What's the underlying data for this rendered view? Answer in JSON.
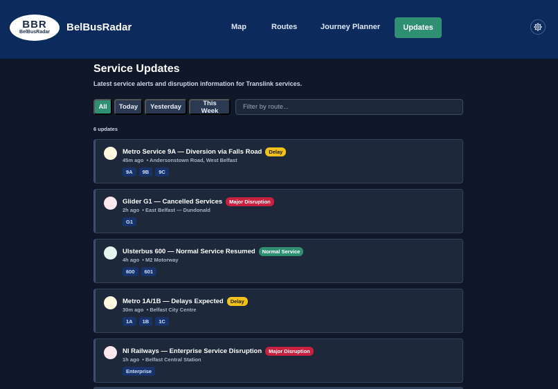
{
  "header": {
    "logo_text": "BBR",
    "logo_subtext": "BelBusRadar",
    "brand": "BelBusRadar",
    "nav": [
      "Map",
      "Routes",
      "Journey Planner",
      "Updates"
    ],
    "active_nav": "Updates",
    "settings_icon": "gear-icon"
  },
  "page": {
    "title": "Service Updates",
    "subtitle": "Latest service alerts and disruption information for Translink services.",
    "filters": [
      "All",
      "Today",
      "Yesterday",
      "This Week"
    ],
    "active_filter": "All",
    "route_filter_placeholder": "Filter by route...",
    "count_text": "6 updates"
  },
  "colors": {
    "accent": "#2f8f72",
    "nav_bg": "#0c2a5c",
    "delay_badge": "#f2c21b",
    "major_disruption_badge": "#c8203f",
    "normal_service_badge": "#2f8f72"
  },
  "updates": [
    {
      "title": "Metro Service 9A — Diversion via Falls Road",
      "status": "Delay",
      "time": "45m ago",
      "location": "• Andersonstown Road, West Belfast",
      "routes": [
        "9A",
        "9B",
        "9C"
      ]
    },
    {
      "title": "Glider G1 — Cancelled Services",
      "status": "Major Disruption",
      "time": "2h ago",
      "location": "• East Belfast — Dundonald",
      "routes": [
        "G1"
      ]
    },
    {
      "title": "Ulsterbus 600 — Normal Service Resumed",
      "status": "Normal Service",
      "time": "4h ago",
      "location": "• M2 Motorway",
      "routes": [
        "600",
        "601"
      ]
    },
    {
      "title": "Metro 1A/1B — Delays Expected",
      "status": "Delay",
      "time": "30m ago",
      "location": "• Belfast City Centre",
      "routes": [
        "1A",
        "1B",
        "1C"
      ]
    },
    {
      "title": "NI Railways — Enterprise Service Disruption",
      "status": "Major Disruption",
      "time": "1h ago",
      "location": "• Belfast Central Station",
      "routes": [
        "Enterprise"
      ]
    }
  ]
}
